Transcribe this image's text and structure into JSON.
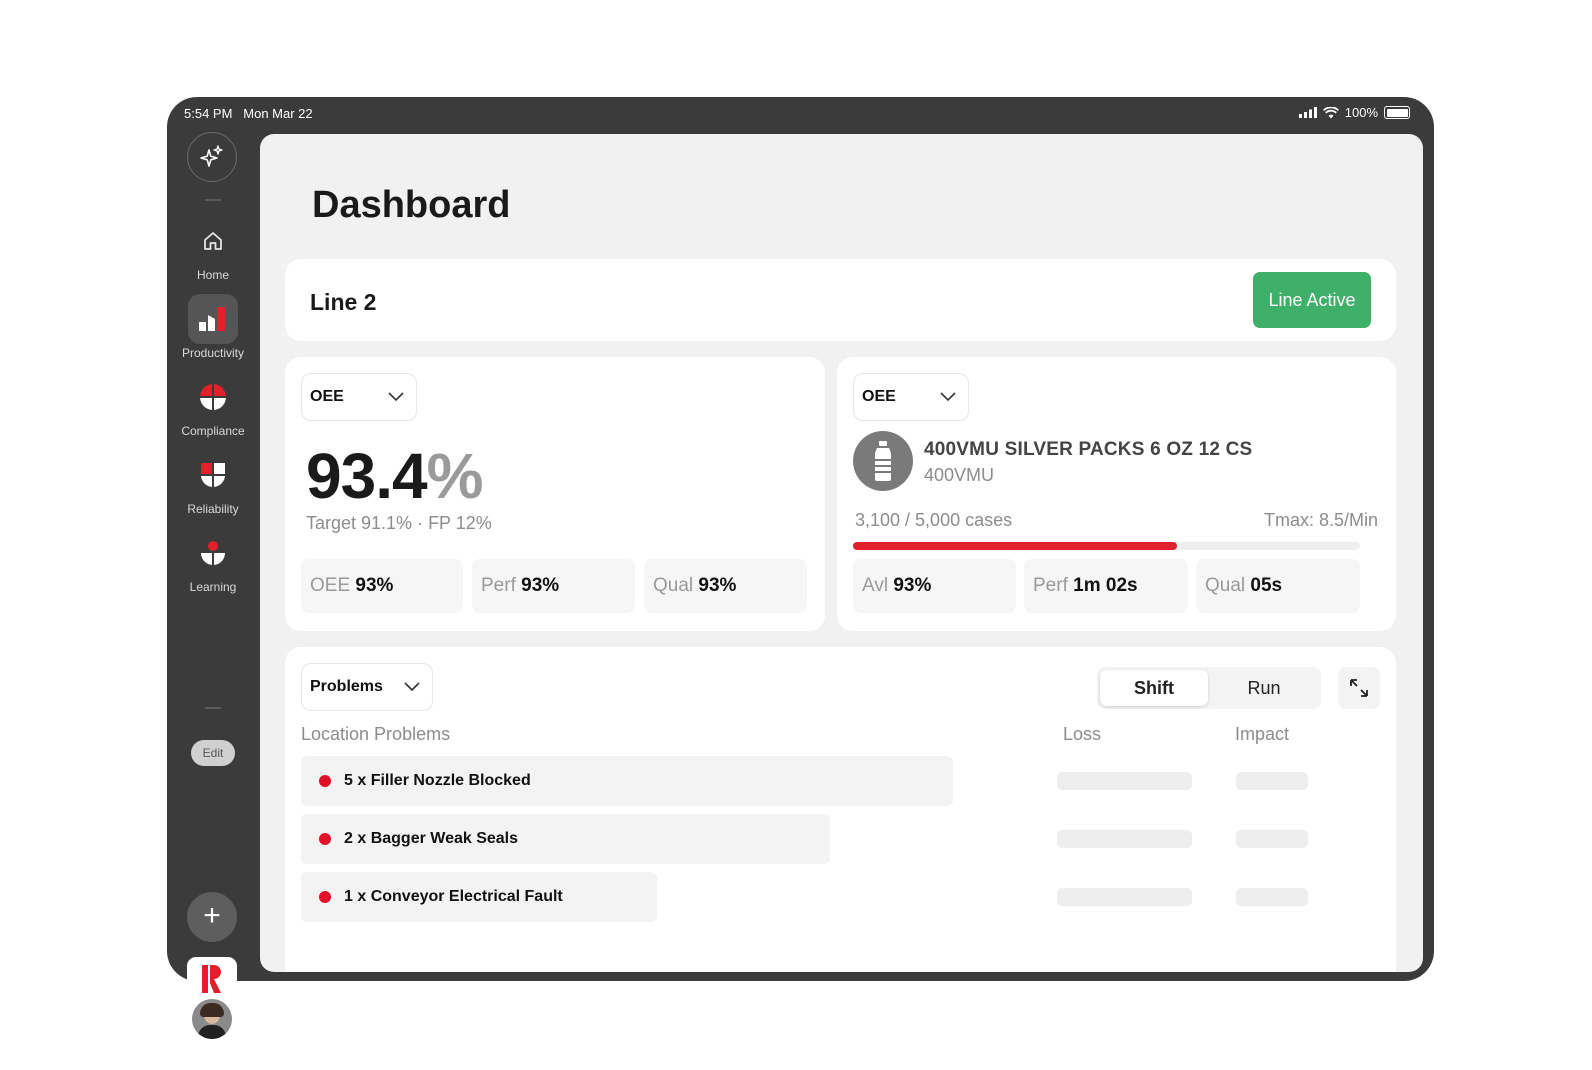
{
  "status_bar": {
    "time": "5:54 PM",
    "date": "Mon Mar 22",
    "battery": "100%"
  },
  "sidebar": {
    "items": [
      {
        "label": "Home",
        "icon": "home-icon"
      },
      {
        "label": "Productivity",
        "icon": "productivity-icon",
        "active": true
      },
      {
        "label": "Compliance",
        "icon": "compliance-icon"
      },
      {
        "label": "Reliability",
        "icon": "reliability-icon"
      },
      {
        "label": "Learning",
        "icon": "learning-icon"
      }
    ],
    "edit_label": "Edit",
    "add_label": "+"
  },
  "page": {
    "title": "Dashboard"
  },
  "line": {
    "name": "Line 2",
    "status": "Line Active"
  },
  "oee_card": {
    "dropdown": "OEE",
    "value": "93.4",
    "unit": "%",
    "subtext": "Target 91.1% · FP 12%",
    "metrics": [
      {
        "key": "OEE",
        "value": "93%"
      },
      {
        "key": "Perf",
        "value": "93%"
      },
      {
        "key": "Qual",
        "value": "93%"
      }
    ]
  },
  "product_card": {
    "dropdown": "OEE",
    "product_name": "400VMU SILVER PACKS 6 OZ 12 CS",
    "product_code": "400VMU",
    "cases": "3,100 / 5,000 cases",
    "tmax": "Tmax: 8.5/Min",
    "progress": 0.64,
    "metrics": [
      {
        "key": "Avl",
        "value": "93%"
      },
      {
        "key": "Perf",
        "value": "1m 02s"
      },
      {
        "key": "Qual",
        "value": "05s"
      }
    ]
  },
  "problems_card": {
    "dropdown": "Problems",
    "segments": [
      "Shift",
      "Run"
    ],
    "selected_segment": "Shift",
    "columns": {
      "location": "Location Problems",
      "loss": "Loss",
      "impact": "Impact"
    },
    "rows": [
      {
        "label": "5 x Filler Nozzle Blocked"
      },
      {
        "label": "2 x Bagger Weak Seals"
      },
      {
        "label": "1 x Conveyor Electrical Fault"
      }
    ]
  },
  "colors": {
    "accent": "#e0202a",
    "active_green": "#3fb069",
    "frame": "#3b3b3b"
  }
}
